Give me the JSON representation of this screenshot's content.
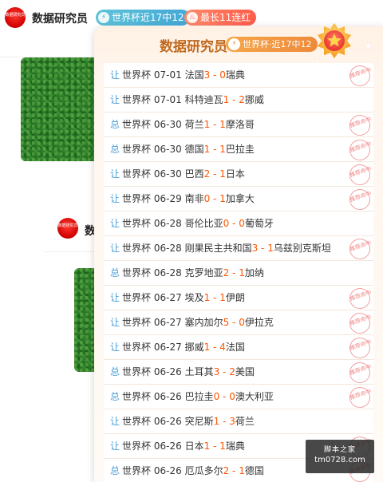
{
  "header": {
    "author_name": "数据研究员",
    "avatar_text": "数据研究员",
    "tag_blue": "世界杯近17中12",
    "tag_red": "最长11连红"
  },
  "background": {
    "author2_name": "数",
    "avatar2_text": "数据研究员"
  },
  "popup": {
    "title": "数据研究员",
    "badge": "世界杯·近17中12",
    "stamp_text": "推荐命中",
    "rows": [
      {
        "type": "让",
        "league": "世界杯",
        "date": "07-01",
        "home": "法国",
        "hs": "3",
        "sep": " - ",
        "as": "0",
        "away": "瑞典",
        "hit": true
      },
      {
        "type": "让",
        "league": "世界杯",
        "date": "07-01",
        "home": "科特迪瓦",
        "hs": "1",
        "sep": " - ",
        "as": "2",
        "away": "挪威",
        "hit": false
      },
      {
        "type": "总",
        "league": "世界杯",
        "date": "06-30",
        "home": "荷兰",
        "hs": "1",
        "sep": " - ",
        "as": "1",
        "away": "摩洛哥",
        "hit": true
      },
      {
        "type": "总",
        "league": "世界杯",
        "date": "06-30",
        "home": "德国",
        "hs": "1",
        "sep": " - ",
        "as": "1",
        "away": "巴拉圭",
        "hit": true
      },
      {
        "type": "让",
        "league": "世界杯",
        "date": "06-30",
        "home": "巴西",
        "hs": "2",
        "sep": " - ",
        "as": "1",
        "away": "日本",
        "hit": true
      },
      {
        "type": "让",
        "league": "世界杯",
        "date": "06-29",
        "home": "南非",
        "hs": "0",
        "sep": " - ",
        "as": "1",
        "away": "加拿大",
        "hit": true
      },
      {
        "type": "让",
        "league": "世界杯",
        "date": "06-28",
        "home": "哥伦比亚",
        "hs": "0",
        "sep": " - ",
        "as": "0",
        "away": "葡萄牙",
        "hit": false
      },
      {
        "type": "让",
        "league": "世界杯",
        "date": "06-28",
        "home": "刚果民主共和国",
        "hs": "3",
        "sep": " - ",
        "as": "1",
        "away": "乌兹别克斯坦",
        "hit": true
      },
      {
        "type": "总",
        "league": "世界杯",
        "date": "06-28",
        "home": "克罗地亚",
        "hs": "2",
        "sep": " - ",
        "as": "1",
        "away": "加纳",
        "hit": false
      },
      {
        "type": "让",
        "league": "世界杯",
        "date": "06-27",
        "home": "埃及",
        "hs": "1",
        "sep": " - ",
        "as": "1",
        "away": "伊朗",
        "hit": true
      },
      {
        "type": "让",
        "league": "世界杯",
        "date": "06-27",
        "home": "塞内加尔",
        "hs": "5",
        "sep": " - ",
        "as": "0",
        "away": "伊拉克",
        "hit": true
      },
      {
        "type": "让",
        "league": "世界杯",
        "date": "06-27",
        "home": "挪威",
        "hs": "1",
        "sep": " - ",
        "as": "4",
        "away": "法国",
        "hit": true
      },
      {
        "type": "总",
        "league": "世界杯",
        "date": "06-26",
        "home": "土耳其",
        "hs": "3",
        "sep": " - ",
        "as": "2",
        "away": "美国",
        "hit": true
      },
      {
        "type": "总",
        "league": "世界杯",
        "date": "06-26",
        "home": "巴拉圭",
        "hs": "0",
        "sep": " - ",
        "as": "0",
        "away": "澳大利亚",
        "hit": true
      },
      {
        "type": "让",
        "league": "世界杯",
        "date": "06-26",
        "home": "突尼斯",
        "hs": "1",
        "sep": " - ",
        "as": "3",
        "away": "荷兰",
        "hit": false
      },
      {
        "type": "让",
        "league": "世界杯",
        "date": "06-26",
        "home": "日本",
        "hs": "1",
        "sep": " - ",
        "as": "1",
        "away": "瑞典",
        "hit": true
      },
      {
        "type": "总",
        "league": "世界杯",
        "date": "06-26",
        "home": "厄瓜多尔",
        "hs": "2",
        "sep": " - ",
        "as": "1",
        "away": "德国",
        "hit": true
      }
    ]
  },
  "watermark": {
    "line1": "脚本之家",
    "line2": "tm0728.com"
  }
}
